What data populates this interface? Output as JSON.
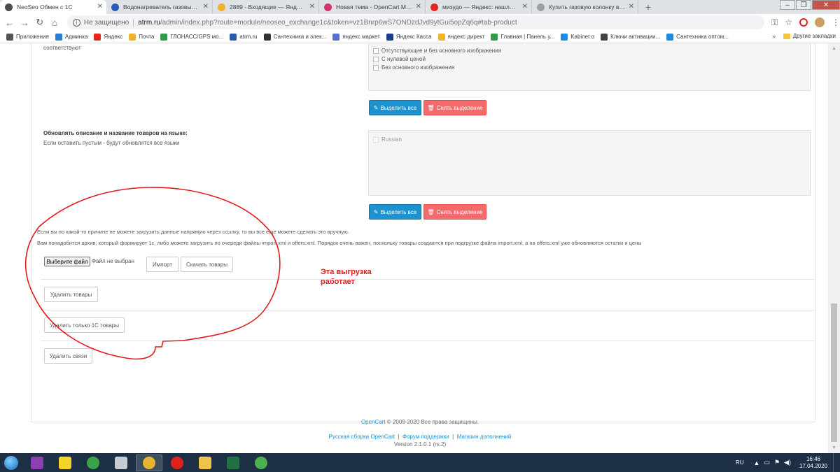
{
  "browser": {
    "tabs": [
      {
        "title": "NeoSeo Обмен с 1С",
        "favicon": "chrome-icon",
        "color": "#4a4a4a",
        "active": true
      },
      {
        "title": "Водонагреватель газовый прот",
        "favicon": "c-icon",
        "color": "#2a5db0"
      },
      {
        "title": "2889 · Входящие — Яндекс.Почт",
        "favicon": "mail-icon",
        "color": "#f0b429"
      },
      {
        "title": "Новая тема - OpenCart Masters",
        "favicon": "ns-icon",
        "color": "#d6336c"
      },
      {
        "title": "мизудо — Яндекс: нашлось 130",
        "favicon": "yandex-icon",
        "color": "#e52620"
      },
      {
        "title": "Купить газовую колонку в Туле",
        "favicon": "generic-icon",
        "color": "#9aa0a6"
      }
    ],
    "address": {
      "security": "Не защищено",
      "host": "atrm.ru",
      "path": "/admin/index.php?route=module/neoseo_exchange1c&token=vz1Bnrp6wS7ONDzdJvd9ytGui5opZq6q#tab-product"
    },
    "bookmarks": [
      {
        "label": "Приложения",
        "icon": "apps-icon",
        "color": "#555"
      },
      {
        "label": "Админка",
        "icon": "admin-icon",
        "color": "#2a7fd4"
      },
      {
        "label": "Яндекс",
        "icon": "yandex-icon",
        "color": "#e52620"
      },
      {
        "label": "Почта",
        "icon": "mail-icon",
        "color": "#f0b429"
      },
      {
        "label": "ГЛОНАСС/GPS мо...",
        "icon": "glonass-icon",
        "color": "#2e9d4a"
      },
      {
        "label": "atrm.ru",
        "icon": "c-icon",
        "color": "#2a5db0"
      },
      {
        "label": "Сантехника и элек...",
        "icon": "w-icon",
        "color": "#333"
      },
      {
        "label": "яндекс маркет",
        "icon": "market-icon",
        "color": "#5b6dd6"
      },
      {
        "label": "Яндекс Касса",
        "icon": "kassa-icon",
        "color": "#1b3d8f"
      },
      {
        "label": "яндекс директ",
        "icon": "direct-icon",
        "color": "#f0b429"
      },
      {
        "label": "Главная | Панель у...",
        "icon": "panel-icon",
        "color": "#2e9d4a"
      },
      {
        "label": "Kabinet α",
        "icon": "kabinet-icon",
        "color": "#1e88e5"
      },
      {
        "label": "Ключи активации...",
        "icon": "keys-icon",
        "color": "#444"
      },
      {
        "label": "Сантехника оптом...",
        "icon": "santeh-icon",
        "color": "#1e88e5"
      }
    ],
    "bookmarks_more": "»",
    "bookmarks_other": "Другие закладки"
  },
  "page": {
    "top_label_tail": "соответствуют",
    "filter_options": [
      "Отсутствующие и без основного изображения",
      "С нулевой ценой",
      "Без основного изображения"
    ],
    "select_all_label": "Выделить все",
    "deselect_label": "Снять выделение",
    "lang_section": {
      "title": "Обновлять описание и название товаров на языке:",
      "hint": "Если оставить пустым - будут обновлятся все языки",
      "options": [
        "Russian"
      ]
    },
    "manual_info_1": "Если вы по какой-то причине не можете загрузить данные напрямую через ссылку, то вы все еще можете сделать это вручную.",
    "manual_info_2": "Вам понадобится архив, который формирует 1с, либо можете загрузить по очереди файлы import.xml и offers.xml. Порядок очень важен, поскольку товары создаются при подгрузке файла import.xml, а на offers.xml уже обновляются остатки и цены",
    "file_button": "Выберите файл",
    "file_status": "Файл не выбран",
    "import_button": "Импорт",
    "download_button": "Скачать товары",
    "delete_products_button": "Удалить товары",
    "delete_1c_products_button": "Удалить только 1С товары",
    "delete_links_button": "Удалить связи",
    "annotation_line1": "Эта выгрузка",
    "annotation_line2": "работает",
    "annotation_color": "#e31a1a",
    "footer": {
      "copyright_link": "OpenCart",
      "copyright_rest": " © 2009-2020 Все права защищены.",
      "links": [
        "Русская сборка OpenCart",
        "Форум поддержки",
        "Магазин дополнений"
      ],
      "separator": "|",
      "version": "Version 2.1.0.1 (rs.2)"
    }
  },
  "taskbar": {
    "apps": [
      {
        "icon": "winrar-icon",
        "color": "#8e3fb5"
      },
      {
        "icon": "1c-icon",
        "color": "#f5d327"
      },
      {
        "icon": "green-app-icon",
        "color": "#3aa34a"
      },
      {
        "icon": "calculator-icon",
        "color": "#c7ccd2"
      },
      {
        "icon": "chrome-icon",
        "color": "#e7b432",
        "active": true
      },
      {
        "icon": "opera-icon",
        "color": "#e0211b"
      },
      {
        "icon": "explorer-icon",
        "color": "#f1c34d"
      },
      {
        "icon": "excel-icon",
        "color": "#207245"
      },
      {
        "icon": "green-chat-icon",
        "color": "#4caf50"
      }
    ],
    "language": "RU",
    "time": "16:46",
    "date": "17.04.2020"
  }
}
